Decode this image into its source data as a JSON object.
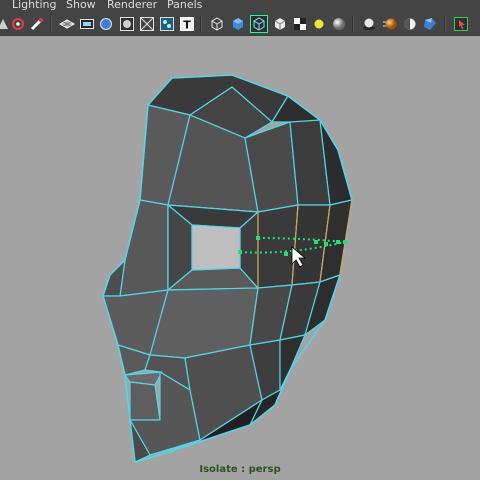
{
  "menu": {
    "items": [
      {
        "label": "Lighting"
      },
      {
        "label": "Show"
      },
      {
        "label": "Renderer"
      },
      {
        "label": "Panels"
      }
    ]
  },
  "toolbar": {
    "icons": [
      "select-camera-icon",
      "lock-camera-icon",
      "bookmark-icon",
      "grid-icon",
      "film-gate-icon",
      "resolution-gate-icon",
      "safe-area-icon",
      "field-chart-icon",
      "texture-icon",
      "wireframe-on-shaded-icon",
      "smooth-shade-icon",
      "xray-icon",
      "isolate-select-icon",
      "default-light-icon",
      "use-all-lights-icon",
      "shadows-icon",
      "high-quality-icon",
      "screen-space-ao-icon",
      "motion-blur-icon",
      "multisample-icon",
      "camera-attributes-icon"
    ]
  },
  "viewport": {
    "hud_label": "Isolate : persp",
    "wire_color": "#55d5e8",
    "edge_loop_color": "#22e07a"
  }
}
